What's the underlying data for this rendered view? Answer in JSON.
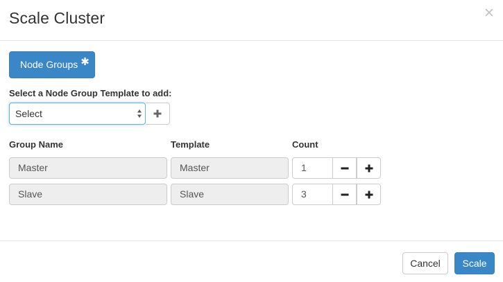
{
  "dialog": {
    "title": "Scale Cluster",
    "close_icon": "close-icon"
  },
  "tabs": [
    {
      "label": "Node Groups",
      "required_marker": "✱",
      "active": true
    }
  ],
  "template_selector": {
    "label": "Select a Node Group Template to add:",
    "selected": "Select",
    "add_icon": "plus-icon"
  },
  "columns": {
    "group_name": "Group Name",
    "template": "Template",
    "count": "Count"
  },
  "node_groups": [
    {
      "group_name": "Master",
      "template": "Master",
      "count": "1"
    },
    {
      "group_name": "Slave",
      "template": "Slave",
      "count": "3"
    }
  ],
  "footer": {
    "cancel_label": "Cancel",
    "scale_label": "Scale"
  },
  "colors": {
    "primary": "#3a87c8",
    "focus_border": "#66afe9",
    "readonly_bg": "#eeeeee",
    "border": "#cccccc"
  }
}
